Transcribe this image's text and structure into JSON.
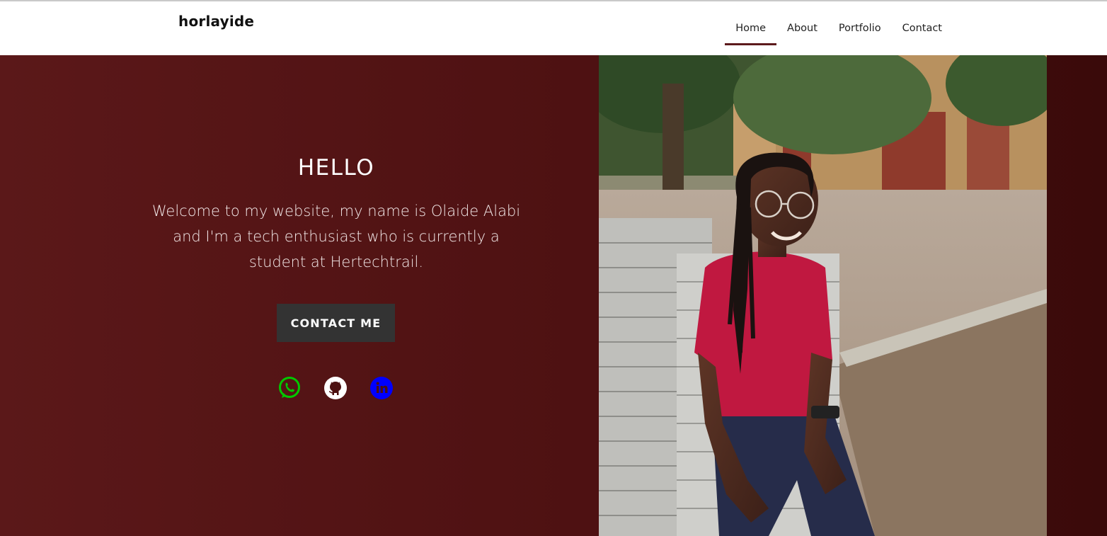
{
  "brand": "horlayide",
  "nav": {
    "items": [
      {
        "label": "Home",
        "active": true
      },
      {
        "label": "About",
        "active": false
      },
      {
        "label": "Portfolio",
        "active": false
      },
      {
        "label": "Contact",
        "active": false
      }
    ]
  },
  "hero": {
    "title": "HELLO",
    "text": "Welcome to my website, my name is Olaide Alabi and I'm a tech enthusiast who is currently a student at Hertechtrail.",
    "button_label": "CONTACT ME",
    "socials": [
      {
        "icon": "whatsapp-icon",
        "color": "#00c800"
      },
      {
        "icon": "github-icon",
        "color": "#ffffff"
      },
      {
        "icon": "linkedin-icon",
        "color": "#0000ff"
      }
    ]
  },
  "colors": {
    "accent": "#5c1a1c",
    "hero_bg": "#4c1011",
    "button_bg": "#333333"
  }
}
